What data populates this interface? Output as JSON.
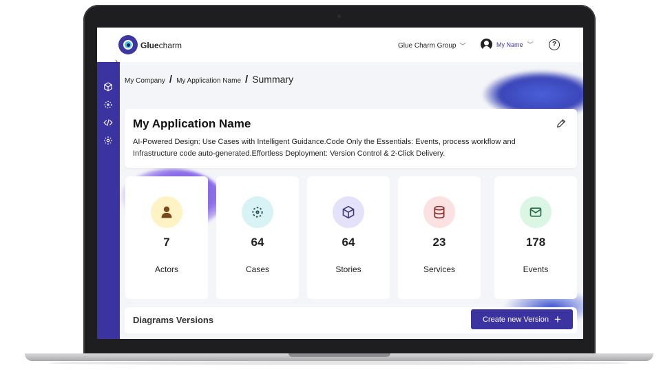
{
  "brand": {
    "bold": "Glue",
    "rest": "charm"
  },
  "header": {
    "org": "Glue Charm Group",
    "user": "My Name",
    "help": "?"
  },
  "breadcrumb": {
    "items": [
      "My Company",
      "My Application Name"
    ],
    "current": "Summary",
    "separator": "/"
  },
  "app": {
    "title": "My Application Name",
    "description": "AI-Powered Design: Use Cases with Intelligent Guidance.Code Only the Essentials: Events, process workflow and Infrastructure code auto-generated.Effortless Deployment: Version Control & 2-Click Delivery."
  },
  "stats": [
    {
      "value": "7",
      "label": "Actors",
      "icon": "person-icon",
      "bg": "#fdf3c4",
      "fg": "#7a4a1e"
    },
    {
      "value": "64",
      "label": "Cases",
      "icon": "use-case-icon",
      "bg": "#d7f3f6",
      "fg": "#2a4b55"
    },
    {
      "value": "64",
      "label": "Stories",
      "icon": "cube-icon",
      "bg": "#e4e2fb",
      "fg": "#3e3a7a"
    },
    {
      "value": "23",
      "label": "Services",
      "icon": "database-icon",
      "bg": "#fbe1e1",
      "fg": "#8a2b2b"
    },
    {
      "value": "178",
      "label": "Events",
      "icon": "mail-icon",
      "bg": "#dcf6e6",
      "fg": "#246b42"
    }
  ],
  "diagrams": {
    "title": "Diagrams Versions",
    "create_label": "Create new Version",
    "create_icon": "+"
  },
  "colors": {
    "accent": "#3b33a0",
    "background": "#f4f5f8"
  }
}
